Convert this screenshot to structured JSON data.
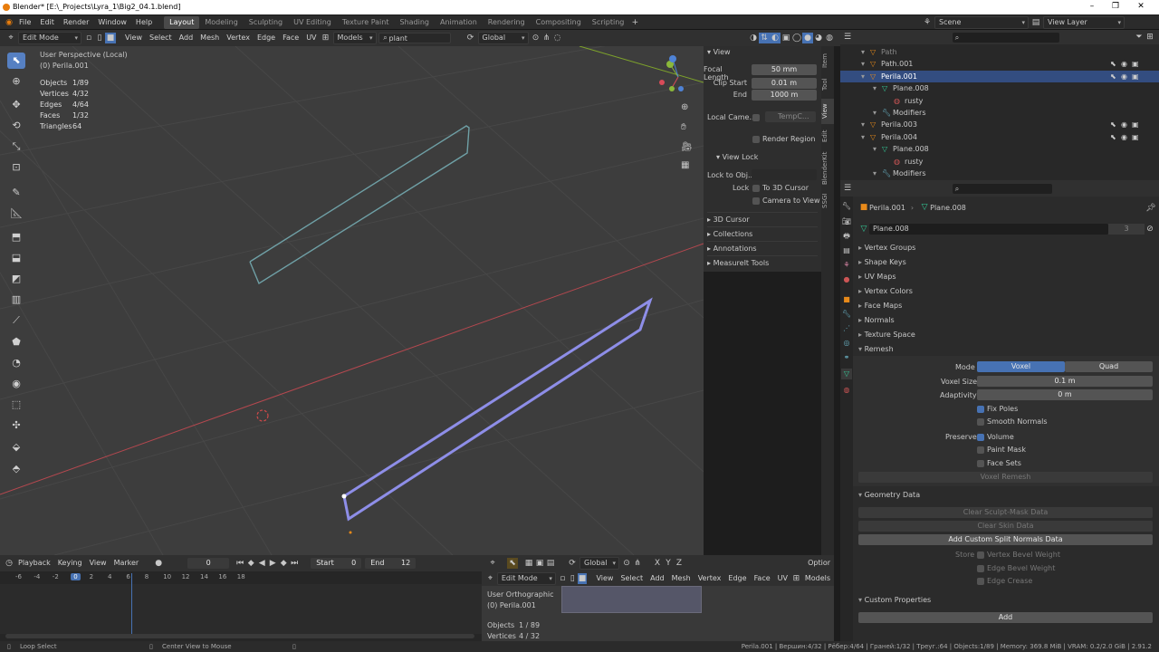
{
  "window": {
    "title": "Blender* [E:\\_Projects\\Lyra_1\\Big2_04.1.blend]"
  },
  "menu": [
    "File",
    "Edit",
    "Render",
    "Window",
    "Help"
  ],
  "workspaces": [
    "Layout",
    "Modeling",
    "Sculpting",
    "UV Editing",
    "Texture Paint",
    "Shading",
    "Animation",
    "Rendering",
    "Compositing",
    "Scripting"
  ],
  "scene": {
    "label": "Scene",
    "view_layer": "View Layer"
  },
  "viewport_header": {
    "mode": "Edit Mode",
    "menus": [
      "View",
      "Select",
      "Add",
      "Mesh",
      "Vertex",
      "Edge",
      "Face",
      "UV"
    ],
    "collection": "Models",
    "search": "plant",
    "orientation": "Global"
  },
  "overlay": {
    "perspective": "User Perspective (Local)",
    "object": "(0) Perila.001",
    "stats": [
      {
        "k": "Objects",
        "v": "1/89"
      },
      {
        "k": "Vertices",
        "v": "4/32"
      },
      {
        "k": "Edges",
        "v": "4/64"
      },
      {
        "k": "Faces",
        "v": "1/32"
      },
      {
        "k": "Triangles",
        "v": "64"
      }
    ]
  },
  "npanel": {
    "header": "View",
    "focal_length_label": "Focal Length",
    "focal_length": "50 mm",
    "clip_start_label": "Clip Start",
    "clip_start": "0.01 m",
    "end_label": "End",
    "clip_end": "1000 m",
    "local_camera_label": "Local Came...",
    "local_camera_placeholder": "TempC...",
    "render_region": "Render Region",
    "view_lock": "View Lock",
    "lock_to_obj": "Lock to Obj...",
    "lock_label": "Lock",
    "to_3d_cursor": "To 3D Cursor",
    "camera_to_view": "Camera to View",
    "collapsed": [
      "3D Cursor",
      "Collections",
      "Annotations",
      "MeasureIt Tools"
    ]
  },
  "side_tabs": [
    "Item",
    "Tool",
    "View",
    "Edit",
    "BlenderKit",
    "SSGI"
  ],
  "outliner": [
    {
      "name": "Path",
      "indent": 1,
      "dim": true
    },
    {
      "name": "Path.001",
      "indent": 1
    },
    {
      "name": "Perila.001",
      "indent": 1,
      "selected": true
    },
    {
      "name": "Plane.008",
      "indent": 2
    },
    {
      "name": "rusty",
      "indent": 3
    },
    {
      "name": "Modifiers",
      "indent": 2
    },
    {
      "name": "Perila.003",
      "indent": 1
    },
    {
      "name": "Perila.004",
      "indent": 1
    },
    {
      "name": "Plane.008",
      "indent": 2
    },
    {
      "name": "rusty",
      "indent": 3
    },
    {
      "name": "Modifiers",
      "indent": 2
    }
  ],
  "properties": {
    "breadcrumb_obj": "Perila.001",
    "breadcrumb_mesh": "Plane.008",
    "mesh_name": "Plane.008",
    "users": "3",
    "sections": [
      "Vertex Groups",
      "Shape Keys",
      "UV Maps",
      "Vertex Colors",
      "Face Maps",
      "Normals",
      "Texture Space"
    ],
    "remesh": {
      "title": "Remesh",
      "mode_label": "Mode",
      "mode_voxel": "Voxel",
      "mode_quad": "Quad",
      "voxel_size_label": "Voxel Size",
      "voxel_size": "0.1 m",
      "adaptivity_label": "Adaptivity",
      "adaptivity": "0 m",
      "fix_poles": "Fix Poles",
      "smooth_normals": "Smooth Normals",
      "preserve_label": "Preserve",
      "volume": "Volume",
      "paint_mask": "Paint Mask",
      "face_sets": "Face Sets",
      "voxel_remesh": "Voxel Remesh"
    },
    "geometry": {
      "title": "Geometry Data",
      "clear_sculpt": "Clear Sculpt-Mask Data",
      "clear_skin": "Clear Skin Data",
      "add_normals": "Add Custom Split Normals Data",
      "store_label": "Store",
      "vbw": "Vertex Bevel Weight",
      "ebw": "Edge Bevel Weight",
      "ecrease": "Edge Crease"
    },
    "custom": {
      "title": "Custom Properties",
      "add": "Add"
    }
  },
  "timeline": {
    "playback": "Playback",
    "keying": "Keying",
    "view": "View",
    "marker": "Marker",
    "frame": "0",
    "start_label": "Start",
    "start": "0",
    "end_label": "End",
    "end": "12",
    "ticks": [
      "-6",
      "-4",
      "-2",
      "0",
      "2",
      "4",
      "6",
      "8",
      "10",
      "12",
      "14",
      "16",
      "18"
    ]
  },
  "uv": {
    "mode": "Edit Mode",
    "menus": [
      "View",
      "Select",
      "Add",
      "Mesh",
      "Vertex",
      "Edge",
      "Face",
      "UV"
    ],
    "orientation": "Global",
    "collection": "Models",
    "overlay": "User Orthographic",
    "object": "(0) Perila.001",
    "objects_label": "Objects",
    "objects": "1 / 89",
    "vertices_label": "Vertices",
    "vertices": "4 / 32",
    "options": "Optior"
  },
  "status": {
    "left": "Loop Select",
    "mid": "Center View to Mouse",
    "right": "Perila.001 | Вершин:4/32 | Рёбер:4/64 | Граней:1/32 | Треуг.:64 | Objects:1/89 | Memory: 369.8 MiB | VRAM: 0.2/2.0 GiB | 2.91.2"
  }
}
